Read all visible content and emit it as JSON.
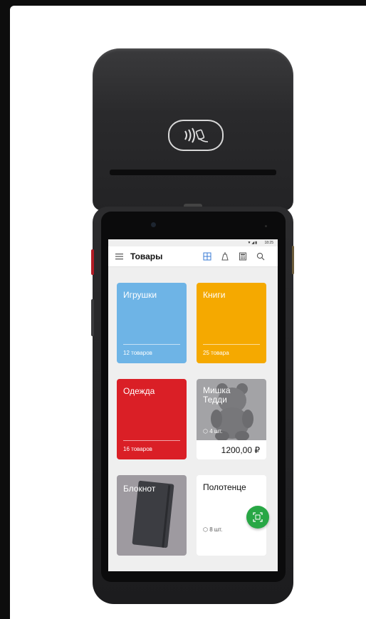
{
  "app": {
    "title": "Товары",
    "status_time": "18:25"
  },
  "tiles": [
    {
      "name": "Игрушки",
      "count": "12 товаров",
      "color": "#6eb4e6"
    },
    {
      "name": "Книги",
      "count": "25 товара",
      "color": "#f5a900"
    },
    {
      "name": "Одежда",
      "count": "16 товаров",
      "color": "#da1f26"
    },
    {
      "name": "Мишка Тедди",
      "stock": "4 шт.",
      "price": "1200,00 ₽"
    },
    {
      "name": "Блокнот"
    },
    {
      "name": "Полотенце",
      "stock": "8 шт."
    }
  ],
  "icons": {
    "menu": "menu-icon",
    "grid_view": "grid-view-icon",
    "scale": "scale-icon",
    "calculator": "calculator-icon",
    "search": "search-icon",
    "scan": "barcode-scan-icon",
    "nfc": "contactless-payment-icon"
  },
  "colors": {
    "accent": "#3a7bd5",
    "fab": "#28a745"
  }
}
